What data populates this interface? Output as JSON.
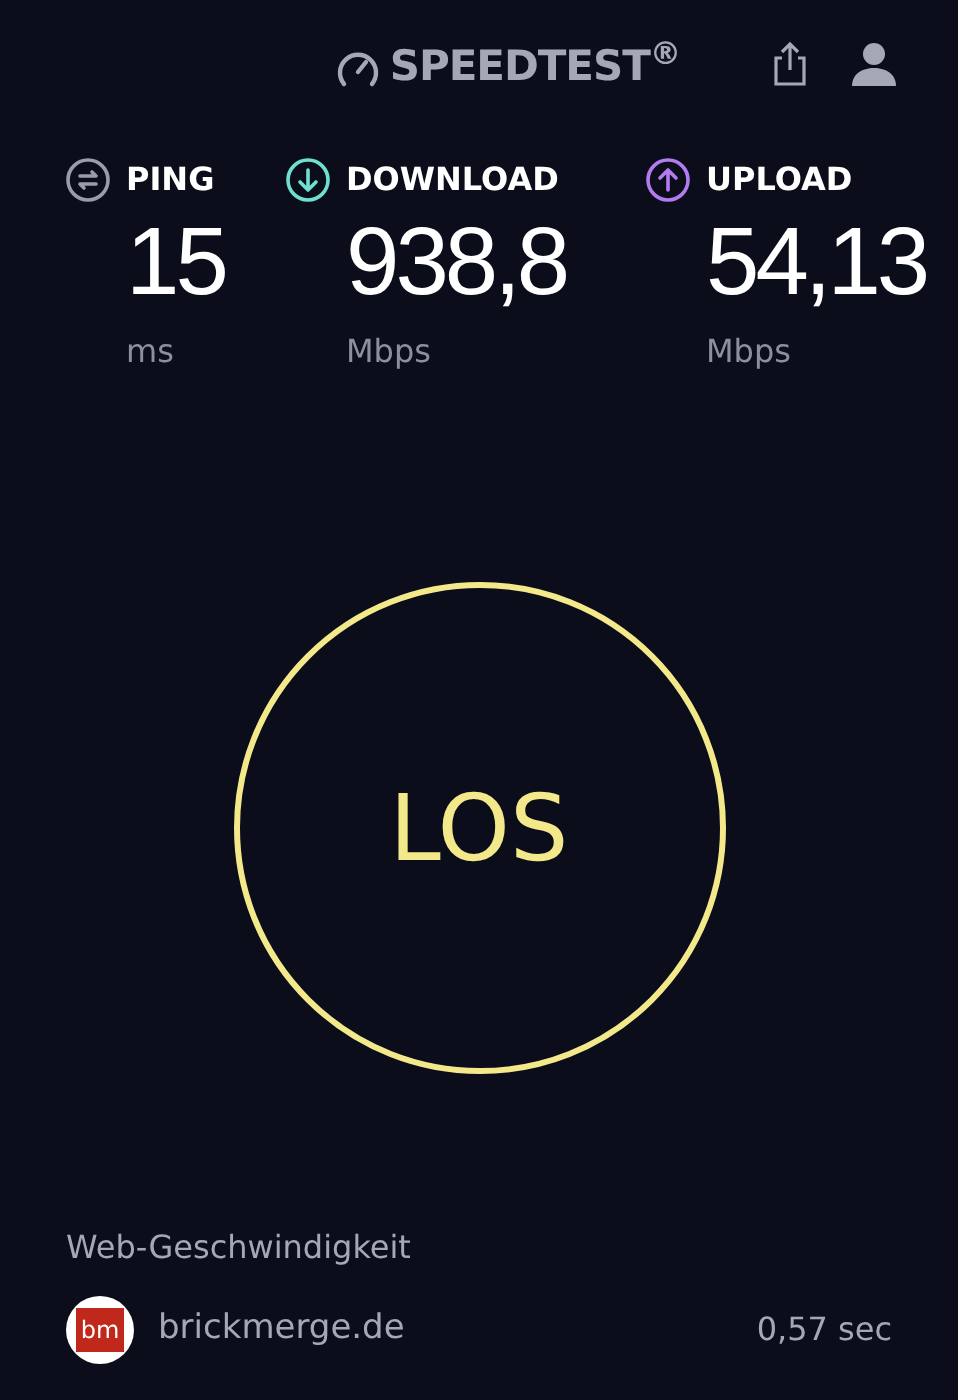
{
  "header": {
    "brand": "SPEEDTEST$^{®}$"
  },
  "metrics": [
    {
      "label": "PING",
      "value": "15",
      "unit": "ms",
      "color": "#9a9caa",
      "kind": "ping"
    },
    {
      "label": "DOWNLOAD",
      "value": "938,8",
      "unit": "Mbps",
      "color": "#6fe0d0",
      "kind": "download"
    },
    {
      "label": "UPLOAD",
      "value": "54,13",
      "unit": "Mbps",
      "color": "#b27cf0",
      "kind": "upload"
    }
  ],
  "start_button": {
    "label": "LOS"
  },
  "web_speed": {
    "title": "Web-Geschwindigkeit",
    "sites": [
      {
        "logo": "bm",
        "name": "brickmerge.de",
        "time": "0,57 sec"
      }
    ]
  }
}
